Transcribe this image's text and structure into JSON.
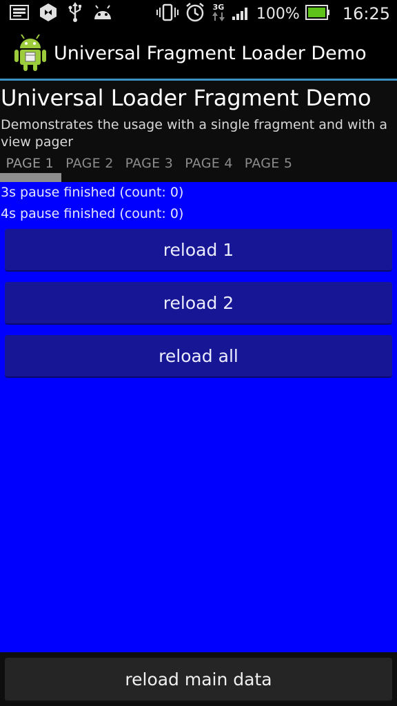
{
  "status_bar": {
    "battery_text": "100%",
    "time": "16:25",
    "network": "3G",
    "icons": [
      "screenshot-icon",
      "app-notification-icon",
      "usb-icon",
      "android-debug-icon",
      "vibrate-icon",
      "alarm-icon",
      "network-3g-icon",
      "signal-icon",
      "battery-icon"
    ]
  },
  "action_bar": {
    "title": "Universal Fragment Loader Demo",
    "icon": "android-robot-icon"
  },
  "header": {
    "title": "Universal Loader Fragment Demo",
    "description": "Demonstrates the usage with a single fragment and with a view pager"
  },
  "tabs": [
    {
      "label": "PAGE 1",
      "active": true
    },
    {
      "label": "PAGE 2",
      "active": false
    },
    {
      "label": "PAGE 3",
      "active": false
    },
    {
      "label": "PAGE 4",
      "active": false
    },
    {
      "label": "PAGE 5",
      "active": false
    }
  ],
  "content": {
    "status_lines": [
      "3s pause finished (count: 0)",
      "4s pause finished (count: 0)"
    ],
    "buttons": [
      {
        "label": "reload 1"
      },
      {
        "label": "reload 2"
      },
      {
        "label": "reload all"
      }
    ]
  },
  "footer": {
    "button_label": "reload main data"
  },
  "colors": {
    "content_background": "#0000ff",
    "button_background": "#171796",
    "action_bar_divider": "#3a93c4",
    "battery_green": "#5ec21a"
  }
}
